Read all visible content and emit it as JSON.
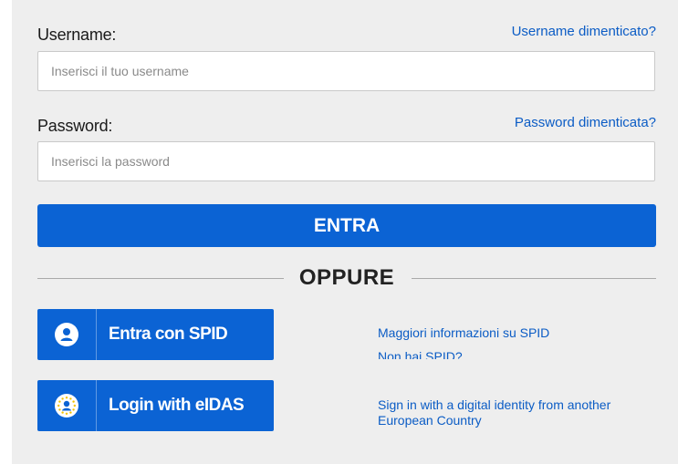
{
  "login": {
    "username_label": "Username:",
    "username_forgot": "Username dimenticato?",
    "username_placeholder": "Inserisci il tuo username",
    "password_label": "Password:",
    "password_forgot": "Password dimenticata?",
    "password_placeholder": "Inserisci la password",
    "submit_label": "ENTRA"
  },
  "divider": {
    "text": "OPPURE"
  },
  "spid": {
    "button_label": "Entra con SPID",
    "icon": "user-icon",
    "info_link": "Maggiori informazioni su SPID",
    "no_spid_link": "Non hai SPID?"
  },
  "eidas": {
    "button_label": "Login with eIDAS",
    "icon": "eu-stars-icon",
    "info_link": "Sign in with a digital identity from another European Country"
  },
  "colors": {
    "primary": "#0b63d4",
    "link": "#0b5cc5",
    "panel_bg": "#eeeeee"
  }
}
